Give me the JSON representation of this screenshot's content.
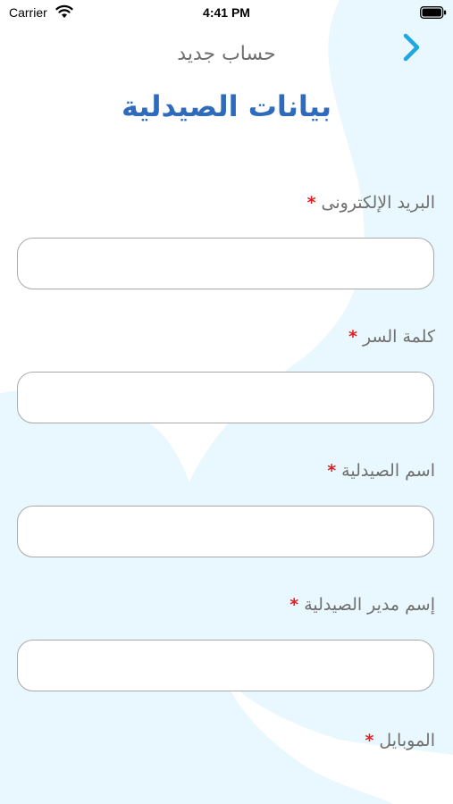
{
  "status_bar": {
    "carrier": "Carrier",
    "time": "4:41 PM"
  },
  "header": {
    "back_icon": "chevron-right-icon",
    "subtitle": "حساب جديد",
    "title": "بيانات الصيدلية"
  },
  "colors": {
    "accent": "#2e6bbd",
    "back_arrow": "#1fa8e0",
    "required": "#e02020",
    "blob": "#e9f8fe"
  },
  "form": {
    "required_mark": "*",
    "fields": [
      {
        "label": "البريد الإلكترونى",
        "value": ""
      },
      {
        "label": "كلمة السر",
        "value": ""
      },
      {
        "label": "اسم الصيدلية",
        "value": ""
      },
      {
        "label": "إسم مدير الصيدلية",
        "value": ""
      },
      {
        "label": "الموبايل",
        "value": ""
      }
    ]
  }
}
